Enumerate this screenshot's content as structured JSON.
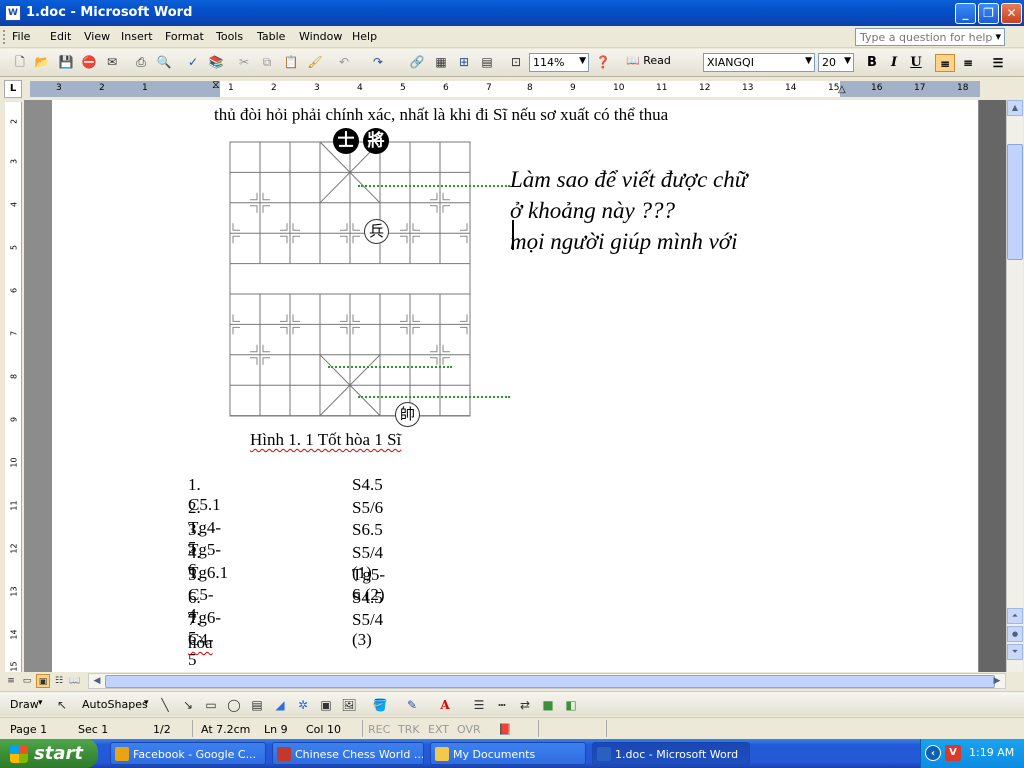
{
  "window": {
    "title": "1.doc - Microsoft Word",
    "app_icon": "W",
    "minimize": "_",
    "restore": "❐",
    "close": "✕"
  },
  "menu": {
    "items": [
      "File",
      "Edit",
      "View",
      "Insert",
      "Format",
      "Tools",
      "Table",
      "Window",
      "Help"
    ],
    "help_placeholder": "Type a question for help"
  },
  "toolbar": {
    "zoom": "114%",
    "read_label": "Read",
    "font_name": "XIANGQI",
    "font_size": "20",
    "bold": "B",
    "italic": "I",
    "underline": "U"
  },
  "ruler": {
    "corner": "L",
    "h_numbers": [
      "3",
      "2",
      "1",
      "1",
      "2",
      "3",
      "4",
      "5",
      "6",
      "7",
      "8",
      "9",
      "10",
      "11",
      "12",
      "13",
      "14",
      "15",
      "16",
      "17",
      "18"
    ],
    "v_numbers": [
      "2",
      "3",
      "4",
      "5",
      "6",
      "7",
      "8",
      "9",
      "10",
      "11",
      "12",
      "13",
      "14",
      "15"
    ]
  },
  "document": {
    "intro_line": "thủ đòi hỏi phải chính xác, nhất là khi đi Sĩ nếu sơ xuất có thể thua",
    "question_lines": [
      "Làm sao để viết được chữ",
      "ở khoảng này ???",
      "mọi người giúp mình với"
    ],
    "caption": "Hình 1. 1 Tốt hòa 1 Sĩ",
    "pieces": {
      "black_advisor": "士",
      "black_general": "將",
      "red_soldier": "兵",
      "red_general": "帥"
    },
    "moves": [
      {
        "left": "1. C5.1",
        "right": "S4.5"
      },
      {
        "left": "2. Tg4-5",
        "right": "S5/6"
      },
      {
        "left": "3. Tg5-6",
        "right": "S6.5"
      },
      {
        "left": "4. Tg6.1",
        "right": "S5/4 (1)"
      },
      {
        "left": "5. C5-4",
        "right": "Tg5-6 (2)"
      },
      {
        "left": "6. Tg6-5",
        "right": "S4.5"
      },
      {
        "left": "7. C4-5",
        "right": "S5/4 (3)"
      }
    ],
    "result": "hòa"
  },
  "drawbar": {
    "draw_label": "Draw",
    "autoshapes_label": "AutoShapes"
  },
  "status": {
    "page": "Page 1",
    "sec": "Sec 1",
    "pages": "1/2",
    "at": "At 7.2cm",
    "ln": "Ln 9",
    "col": "Col 10",
    "rec": "REC",
    "trk": "TRK",
    "ext": "EXT",
    "ovr": "OVR"
  },
  "taskbar": {
    "start": "start",
    "tasks": [
      {
        "label": "Facebook - Google C...",
        "icon_color": "#e8a317"
      },
      {
        "label": "Chinese Chess World ...",
        "icon_color": "#c0392b"
      },
      {
        "label": "My Documents",
        "icon_color": "#f2c94c"
      },
      {
        "label": "1.doc - Microsoft Word",
        "icon_color": "#2b5fc0"
      }
    ],
    "clock": "1:19 AM"
  }
}
